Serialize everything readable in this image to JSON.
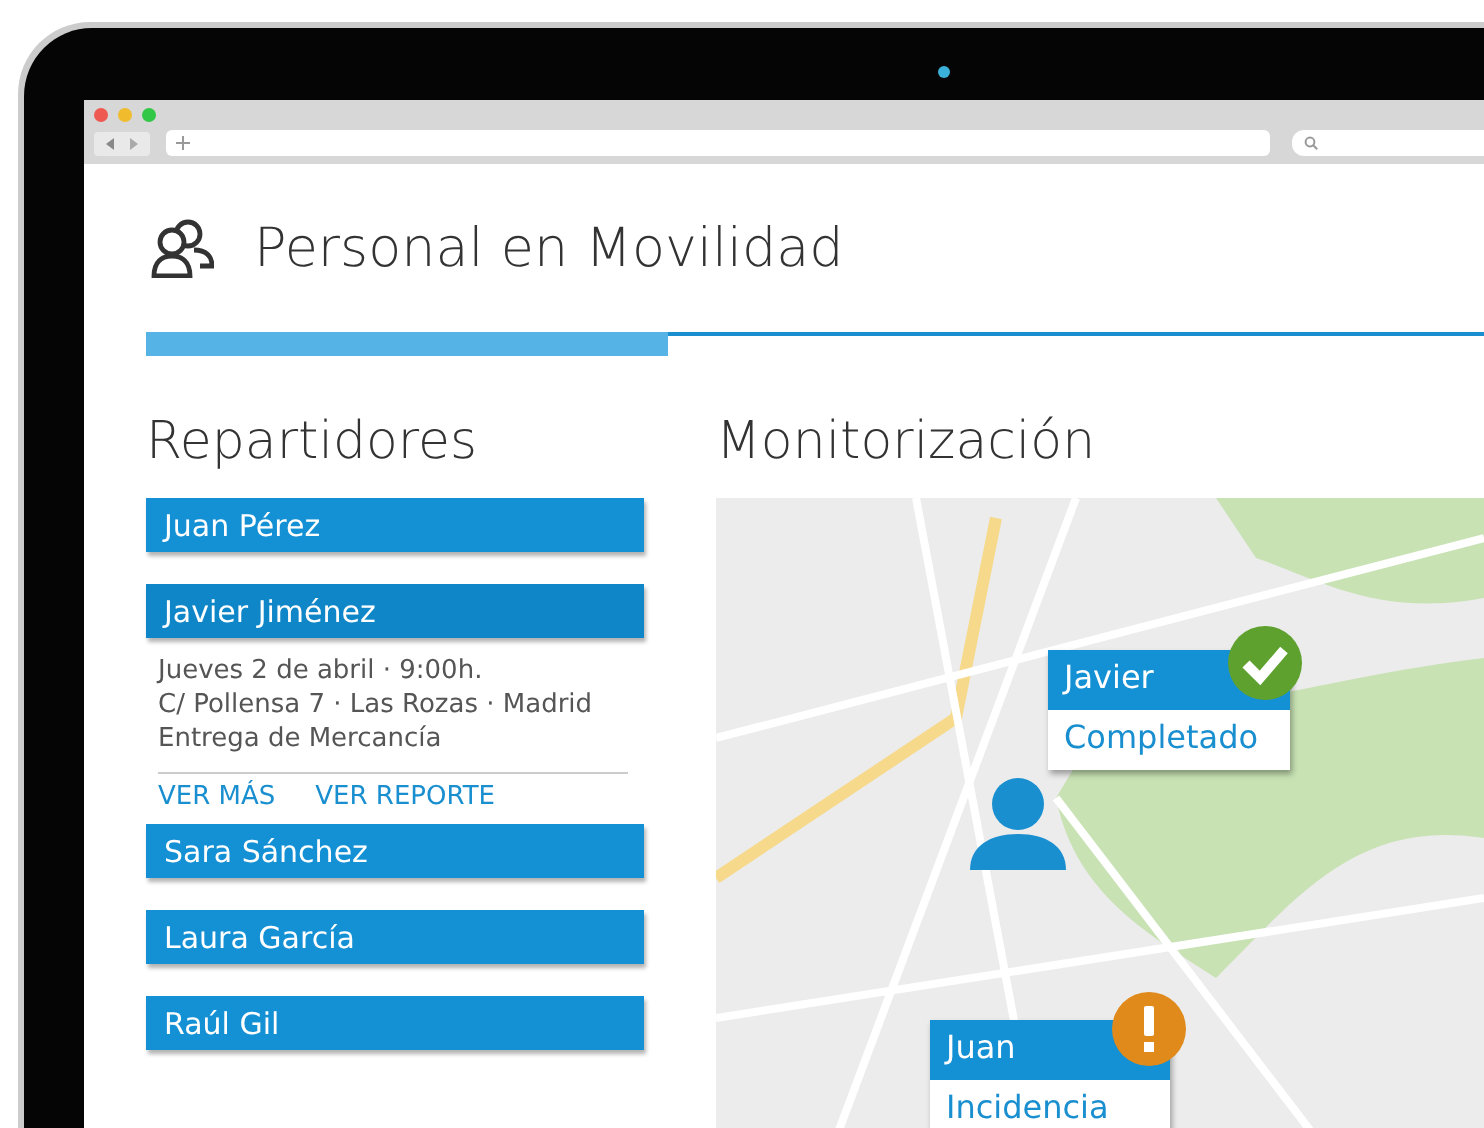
{
  "app": {
    "title": "Personal en Movilidad"
  },
  "progress": {
    "level": 0.39
  },
  "couriers": {
    "heading": "Repartidores",
    "items": [
      {
        "name": "Juan Pérez",
        "expanded": false
      },
      {
        "name": "Javier Jiménez",
        "expanded": true,
        "details": [
          "Jueves 2 de abril · 9:00h.",
          "C/ Pollensa 7 · Las Rozas · Madrid",
          "Entrega de Mercancía"
        ],
        "links": [
          "VER MÁS",
          "VER REPORTE"
        ]
      },
      {
        "name": "Sara Sánchez",
        "expanded": false
      },
      {
        "name": "Laura García",
        "expanded": false
      },
      {
        "name": "Raúl Gil",
        "expanded": false
      }
    ]
  },
  "monitoring": {
    "heading": "Monitorización",
    "markers": [
      {
        "name": "Javier",
        "status": "Completado",
        "kind": "completed"
      },
      {
        "name": "Juan",
        "status": "Incidencia",
        "kind": "incident"
      }
    ]
  }
}
